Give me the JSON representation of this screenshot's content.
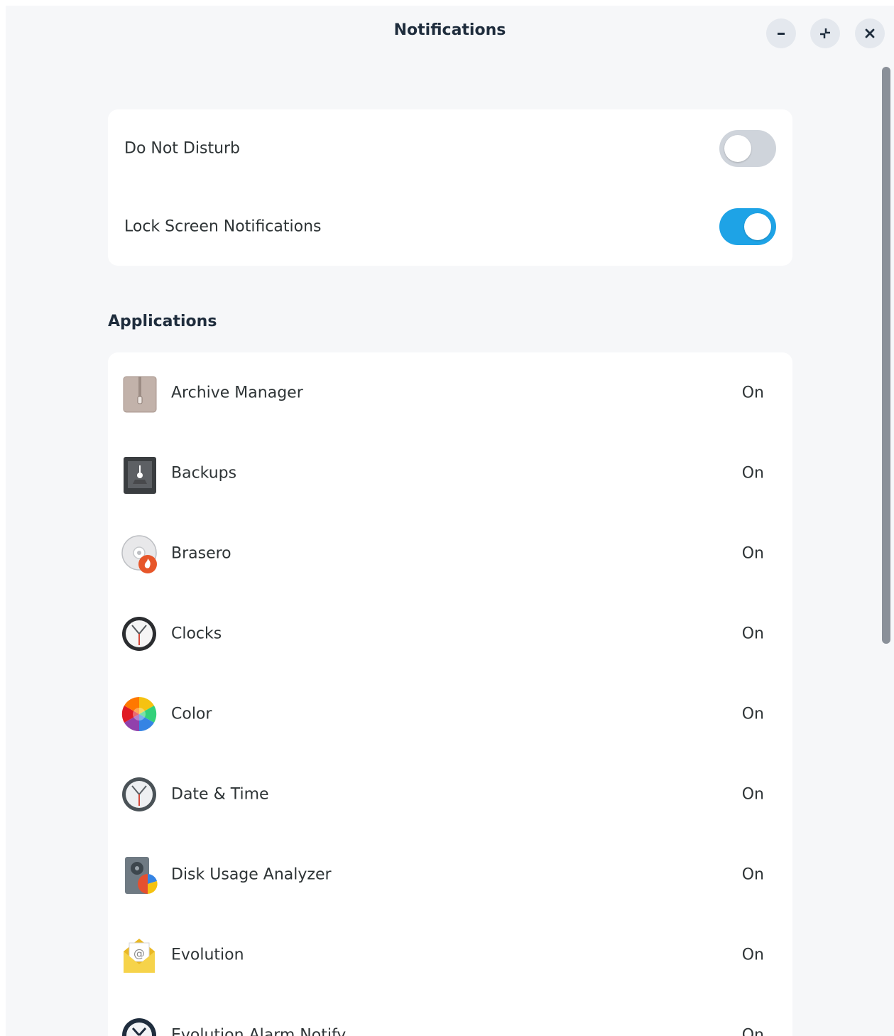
{
  "window": {
    "title": "Notifications",
    "controls": {
      "minimize_icon": "minimize-icon",
      "restore_icon": "restore-icon",
      "close_icon": "close-icon"
    }
  },
  "settings": [
    {
      "label": "Do Not Disturb",
      "enabled": false
    },
    {
      "label": "Lock Screen Notifications",
      "enabled": true
    }
  ],
  "applications_heading": "Applications",
  "applications": [
    {
      "name": "Archive Manager",
      "state": "On",
      "icon": "archive-manager-icon"
    },
    {
      "name": "Backups",
      "state": "On",
      "icon": "backups-icon"
    },
    {
      "name": "Brasero",
      "state": "On",
      "icon": "brasero-icon"
    },
    {
      "name": "Clocks",
      "state": "On",
      "icon": "clocks-icon"
    },
    {
      "name": "Color",
      "state": "On",
      "icon": "color-icon"
    },
    {
      "name": "Date & Time",
      "state": "On",
      "icon": "date-time-icon"
    },
    {
      "name": "Disk Usage Analyzer",
      "state": "On",
      "icon": "disk-usage-analyzer-icon"
    },
    {
      "name": "Evolution",
      "state": "On",
      "icon": "evolution-icon"
    },
    {
      "name": "Evolution Alarm Notify",
      "state": "On",
      "icon": "evolution-alarm-notify-icon"
    }
  ],
  "colors": {
    "accent": "#1ea3e6",
    "toggle_off": "#cfd4db",
    "card": "#ffffff",
    "background": "#f6f7f9"
  }
}
